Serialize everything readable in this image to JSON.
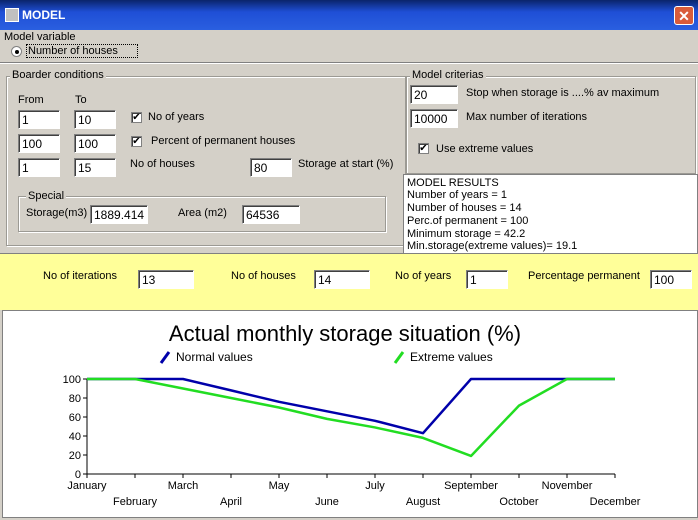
{
  "window": {
    "title": "MODEL",
    "close_symbol": "✕"
  },
  "model_variable": {
    "label": "Model variable",
    "option": "Number of houses"
  },
  "boarder": {
    "label": "Boarder conditions",
    "from_label": "From",
    "to_label": "To",
    "rows": [
      {
        "from": "1",
        "to": "10",
        "label": "No of years",
        "checked": true
      },
      {
        "from": "100",
        "to": "100",
        "label": "Percent of permanent houses",
        "checked": true
      },
      {
        "from": "1",
        "to": "15",
        "label": "No of houses"
      }
    ],
    "storage_start_value": "80",
    "storage_start_label": "Storage at start (%)",
    "special": {
      "label": "Special",
      "storage_label": "Storage(m3)",
      "storage_value": "1889.414",
      "area_label": "Area (m2)",
      "area_value": "64536"
    }
  },
  "criterias": {
    "label": "Model criterias",
    "stop_value": "20",
    "stop_label": "Stop when storage is ....% av maximum",
    "max_value": "10000",
    "max_label": "Max number of iterations",
    "extreme_label": "Use extreme values",
    "extreme_checked": true,
    "check_mark": "✔"
  },
  "results": {
    "lines": [
      "MODEL RESULTS",
      "Number of years =   1",
      "Number of houses =   14",
      "Perc.of permanent =  100",
      "Minimum storage  =   42.2",
      "Min.storage(extreme values)=   19.1"
    ]
  },
  "summary": {
    "iter_label": "No of iterations",
    "iter_value": "13",
    "houses_label": "No of houses",
    "houses_value": "14",
    "years_label": "No of years",
    "years_value": "1",
    "perc_label": "Percentage permanent",
    "perc_value": "100"
  },
  "chart_data": {
    "type": "line",
    "title": "Actual monthly storage situation (%)",
    "categories": [
      "January",
      "February",
      "March",
      "April",
      "May",
      "June",
      "July",
      "August",
      "September",
      "October",
      "November",
      "December"
    ],
    "series": [
      {
        "name": "Normal values",
        "color": "#0000aa",
        "values": [
          100,
          100,
          100,
          88,
          76,
          66,
          56,
          43,
          100,
          100,
          100,
          100
        ]
      },
      {
        "name": "Extreme values",
        "color": "#22dd22",
        "values": [
          100,
          100,
          90,
          80,
          70,
          58,
          49,
          38,
          19,
          72,
          100,
          100
        ]
      }
    ],
    "yticks": [
      0,
      20,
      40,
      60,
      80,
      100
    ],
    "ylim": [
      0,
      100
    ],
    "grid": false,
    "legend": "top"
  }
}
